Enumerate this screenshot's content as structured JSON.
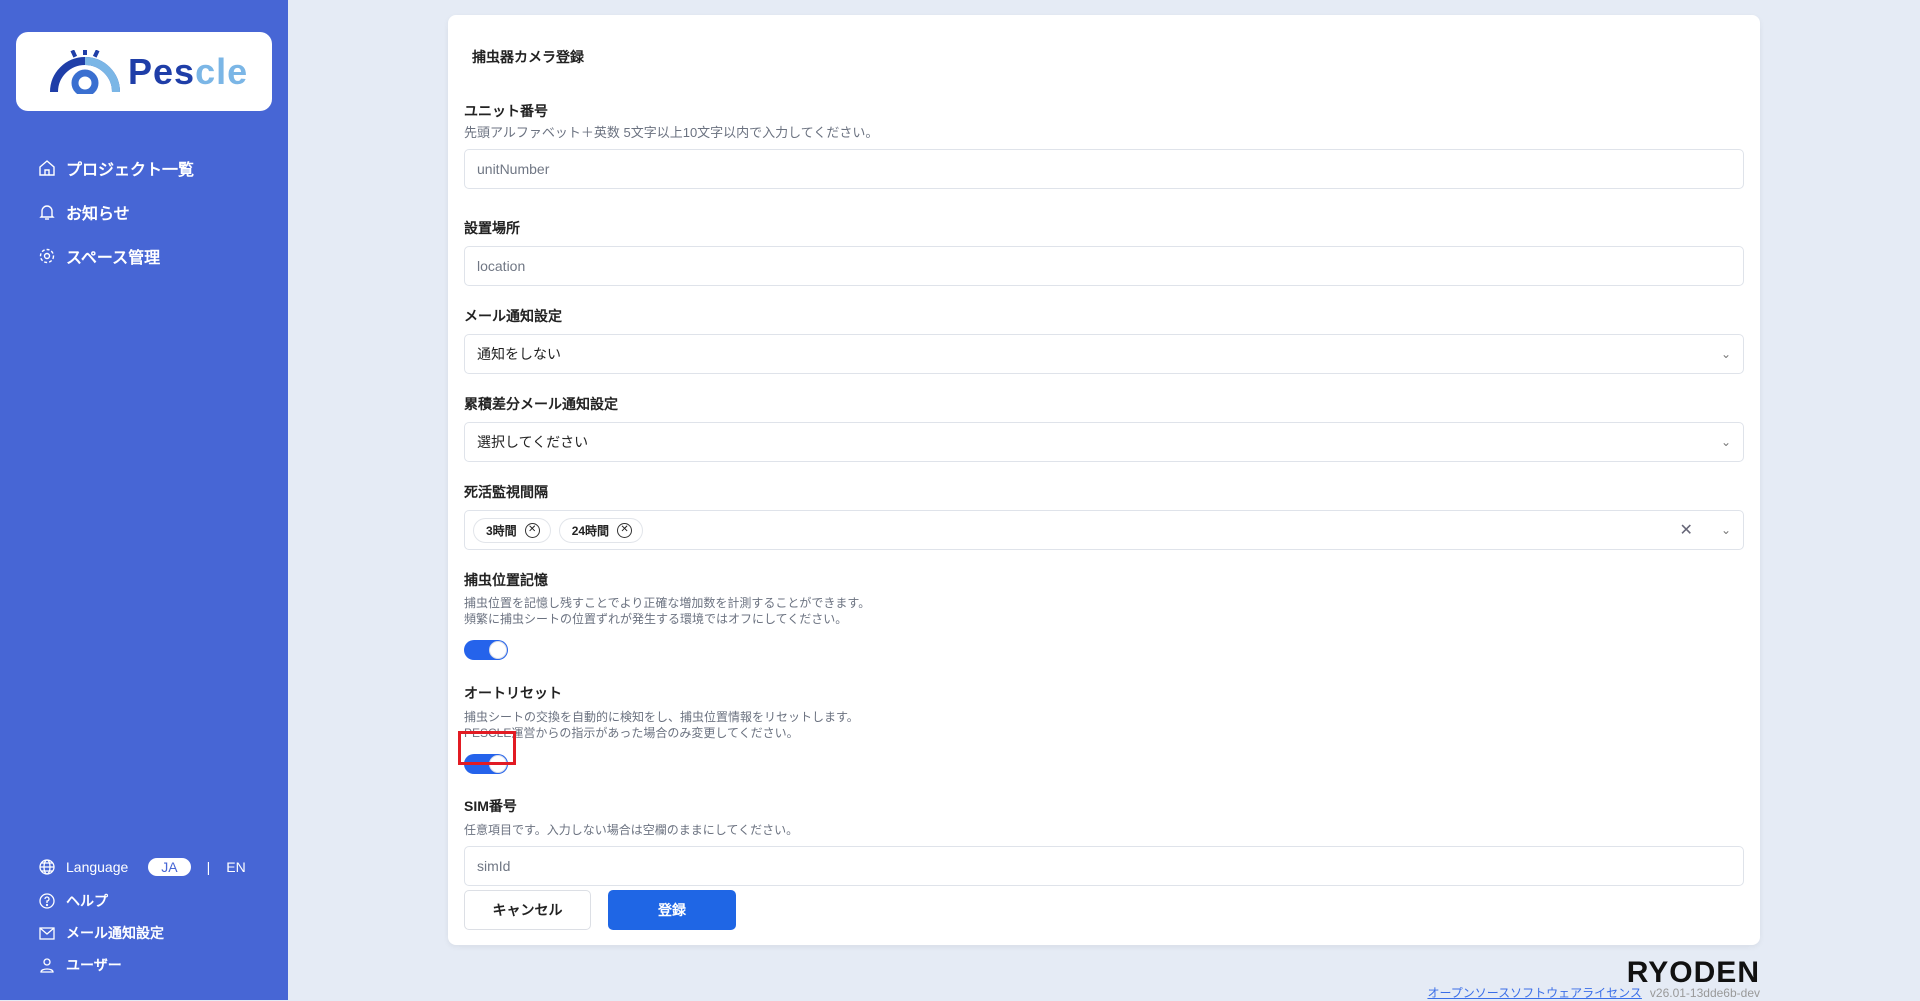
{
  "sidebar": {
    "logo_text_dark": "Pes",
    "logo_text_light": "cle",
    "nav": [
      {
        "label": "プロジェクト一覧",
        "icon": "home-icon"
      },
      {
        "label": "お知らせ",
        "icon": "bell-icon"
      },
      {
        "label": "スペース管理",
        "icon": "gear-icon"
      }
    ],
    "language": {
      "label": "Language",
      "active": "JA",
      "sep": "|",
      "other": "EN"
    },
    "bottom": [
      {
        "label": "ヘルプ",
        "icon": "help-icon"
      },
      {
        "label": "メール通知設定",
        "icon": "mail-icon"
      },
      {
        "label": "ユーザー",
        "icon": "user-icon"
      }
    ]
  },
  "form": {
    "title": "捕虫器カメラ登録",
    "unit": {
      "label": "ユニット番号",
      "hint": "先頭アルファベット＋英数 5文字以上10文字以内で入力してください。",
      "placeholder": "unitNumber"
    },
    "location": {
      "label": "設置場所",
      "placeholder": "location"
    },
    "mail": {
      "label": "メール通知設定",
      "value": "通知をしない"
    },
    "cumulative": {
      "label": "累積差分メール通知設定",
      "value": "選択してください"
    },
    "alive": {
      "label": "死活監視間隔",
      "chips": [
        "3時間",
        "24時間"
      ]
    },
    "position_memory": {
      "label": "捕虫位置記憶",
      "hint1": "捕虫位置を記憶し残すことでより正確な増加数を計測することができます。",
      "hint2": "頻繁に捕虫シートの位置ずれが発生する環境ではオフにしてください。",
      "on": true
    },
    "auto_reset": {
      "label": "オートリセット",
      "hint1": "捕虫シートの交換を自動的に検知をし、捕虫位置情報をリセットします。",
      "hint2": "PESCLE運営からの指示があった場合のみ変更してください。",
      "on": true
    },
    "sim": {
      "label": "SIM番号",
      "hint": "任意項目です。入力しない場合は空欄のままにしてください。",
      "placeholder": "simId"
    },
    "cancel": "キャンセル",
    "submit": "登録"
  },
  "footer": {
    "brand": "RYODEN",
    "oss_link": "オープンソースソフトウェアライセンス",
    "version": "v26.01-13dde6b-dev"
  }
}
